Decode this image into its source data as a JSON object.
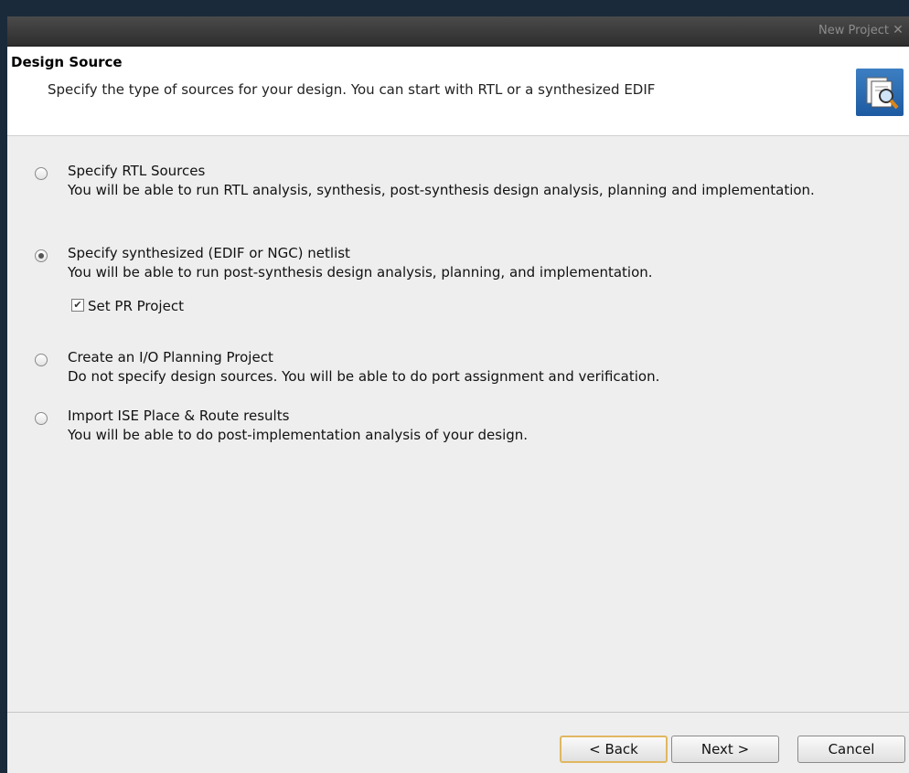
{
  "window": {
    "title": "New Project"
  },
  "header": {
    "title": "Design Source",
    "subtitle": "Specify the type of sources for your design. You can start with RTL or a synthesized EDIF"
  },
  "options": [
    {
      "title": "Specify RTL Sources",
      "description": "You will be able to run RTL analysis, synthesis, post-synthesis design analysis, planning and implementation.",
      "selected": false
    },
    {
      "title": "Specify synthesized (EDIF or NGC) netlist",
      "description": "You will be able to run post-synthesis design analysis, planning, and implementation.",
      "selected": true
    },
    {
      "title": "Create an I/O Planning Project",
      "description": "Do not specify design sources. You will be able to do port assignment and verification.",
      "selected": false
    },
    {
      "title": "Import ISE Place & Route results",
      "description": "You will be able to do post-implementation analysis of your design.",
      "selected": false
    }
  ],
  "pr_project": {
    "label": "Set PR Project",
    "checked": true
  },
  "buttons": {
    "back": "< Back",
    "next": "Next >",
    "cancel": "Cancel"
  },
  "icons": {
    "header": "wizard-document-icon",
    "close": "close-icon"
  }
}
